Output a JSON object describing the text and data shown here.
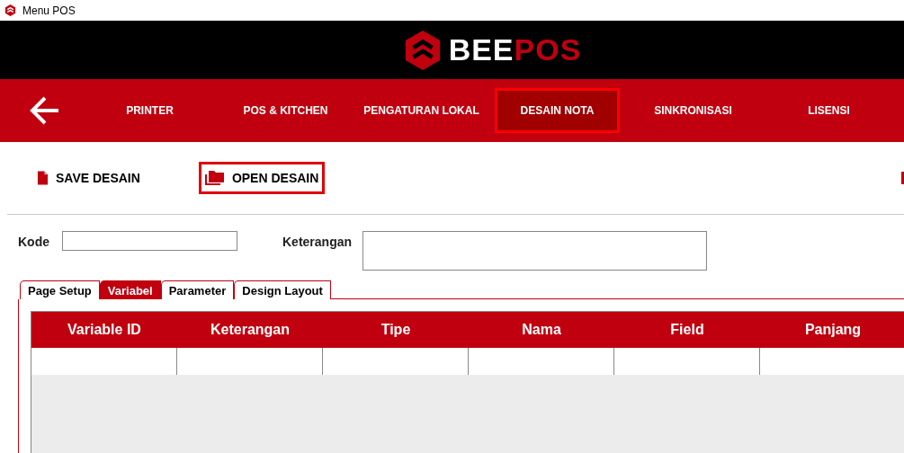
{
  "window": {
    "title": "Menu POS"
  },
  "logo": {
    "part_1": "BEE",
    "part_2": "POS"
  },
  "nav": [
    {
      "label": "PRINTER",
      "selected": false
    },
    {
      "label": "POS & KITCHEN",
      "selected": false
    },
    {
      "label": "PENGATURAN LOKAL",
      "selected": false
    },
    {
      "label": "DESAIN NOTA",
      "selected": true
    },
    {
      "label": "SINKRONISASI",
      "selected": false
    },
    {
      "label": "LISENSI",
      "selected": false
    }
  ],
  "toolbar": [
    {
      "label": "SAVE DESAIN",
      "kind": "save",
      "selected": false
    },
    {
      "label": "OPEN DESAIN",
      "kind": "open",
      "selected": true
    }
  ],
  "form": {
    "kode_label": "Kode",
    "keterangan_label": "Keterangan"
  },
  "tabs": [
    {
      "label": "Page Setup",
      "selected": false
    },
    {
      "label": "Variabel",
      "selected": true
    },
    {
      "label": "Parameter",
      "selected": false
    },
    {
      "label": "Design Layout",
      "selected": false
    }
  ],
  "table": {
    "columns": [
      "Variable ID",
      "Keterangan",
      "Tipe",
      "Nama",
      "Field",
      "Panjang"
    ]
  }
}
